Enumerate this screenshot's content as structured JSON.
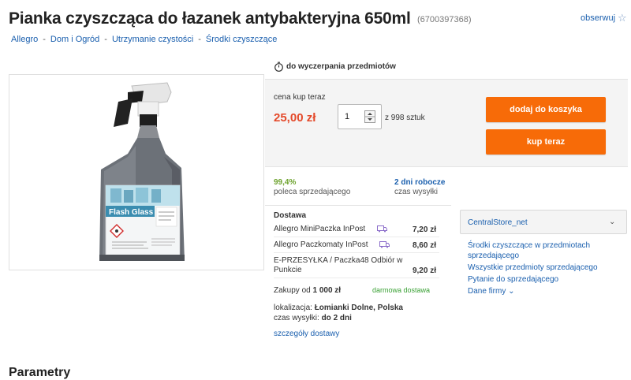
{
  "header": {
    "title": "Pianka czyszcząca do łazanek antybakteryjna 650ml",
    "offer_id": "(6700397368)",
    "watch_label": "obserwuj"
  },
  "breadcrumb": [
    "Allegro",
    "Dom i Ogród",
    "Utrzymanie czystości",
    "Środki czyszczące"
  ],
  "product_image": {
    "brand_text": "Flash Glass"
  },
  "offer": {
    "time_note": "do wyczerpania przedmiotów",
    "buy_label": "cena kup teraz",
    "price": "25,00 zł",
    "quantity": "1",
    "available": "z 998 sztuk",
    "add_to_cart": "dodaj do koszyka",
    "buy_now": "kup teraz"
  },
  "stats": {
    "recommend_value": "99,4%",
    "recommend_label": "poleca sprzedającego",
    "shipping_value": "2 dni robocze",
    "shipping_label": "czas wysyłki"
  },
  "delivery": {
    "title": "Dostawa",
    "options": [
      {
        "name": "Allegro MiniPaczka InPost",
        "price": "7,20 zł",
        "icon": "van-icon"
      },
      {
        "name": "Allegro Paczkomaty InPost",
        "price": "8,60 zł",
        "icon": "van-icon"
      },
      {
        "name_line1": "E-PRZESYŁKA / Paczka48 Odbiór w",
        "name_line2": "Punkcie",
        "price": "9,20 zł"
      }
    ],
    "free_prefix": "Zakupy od",
    "free_amount": "1 000 zł",
    "free_label": "darmowa dostawa",
    "location_label": "lokalizacja:",
    "location_value": "Łomianki Dolne, Polska",
    "time_label": "czas wysyłki:",
    "time_value": "do 2 dni",
    "details_link": "szczegóły dostawy"
  },
  "seller": {
    "name": "CentralStore_net",
    "category_link": "Środki czyszczące",
    "category_suffix": "w przedmiotach sprzedającego",
    "all_items": "Wszystkie przedmioty sprzedającego",
    "ask": "Pytanie do sprzedającego",
    "company_data": "Dane firmy"
  },
  "sections": {
    "params_title": "Parametry"
  },
  "colors": {
    "accent_orange": "#f76b08",
    "price_red": "#e4492a",
    "link_blue": "#1a5fae",
    "positive_green": "#6da22e"
  }
}
